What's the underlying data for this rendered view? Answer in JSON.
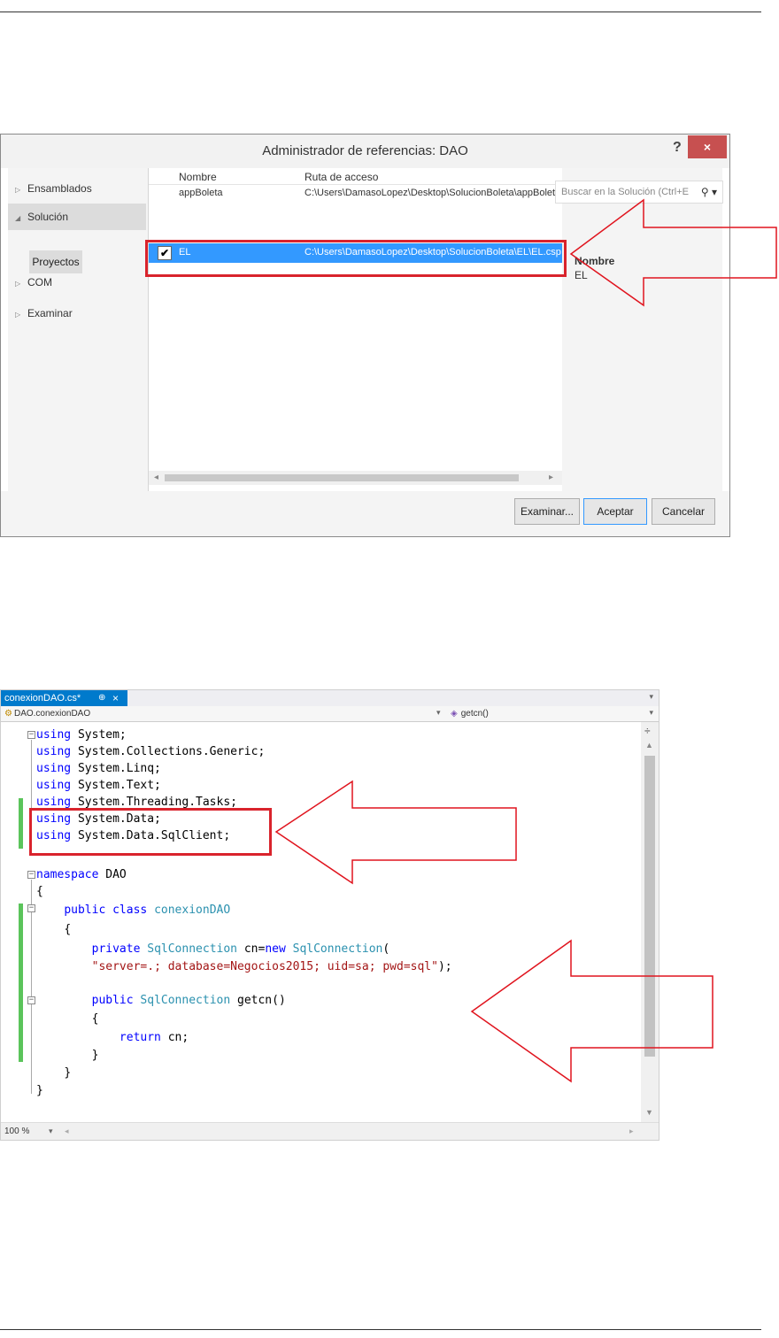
{
  "dialog": {
    "title": "Administrador de referencias: DAO",
    "help_label": "?",
    "close_label": "×",
    "nav": [
      {
        "label": "Ensamblados",
        "expanded": false
      },
      {
        "label": "Solución",
        "expanded": true
      },
      {
        "label": "COM",
        "expanded": false
      },
      {
        "label": "Examinar",
        "expanded": false
      }
    ],
    "nav_subitem": "Proyectos",
    "search_placeholder": "Buscar en la Solución (Ctrl+E",
    "columns": {
      "name": "Nombre",
      "path": "Ruta de acceso"
    },
    "rows": [
      {
        "name": "appBoleta",
        "path": "C:\\Users\\DamasoLopez\\Desktop\\SolucionBoleta\\appBoleta",
        "checked": false,
        "selected": false
      },
      {
        "name": "EL",
        "path": "C:\\Users\\DamasoLopez\\Desktop\\SolucionBoleta\\EL\\EL.csproj",
        "checked": true,
        "selected": true
      }
    ],
    "detail": {
      "header": "Nombre",
      "value": "EL"
    },
    "buttons": {
      "browse": "Examinar...",
      "accept": "Aceptar",
      "cancel": "Cancelar"
    }
  },
  "editor": {
    "tab": {
      "name": "conexionDAO.cs*",
      "pin": "⊕",
      "close": "×"
    },
    "nav_left": "DAO.conexionDAO",
    "nav_right": "getcn()",
    "zoom": "100 %",
    "code": {
      "l1_kw": "using",
      "l1_rest": " System;",
      "l2_kw": "using",
      "l2_rest": " System.Collections.Generic;",
      "l3_kw": "using",
      "l3_rest": " System.Linq;",
      "l4_kw": "using",
      "l4_rest": " System.Text;",
      "l5_kw": "using",
      "l5_rest": " System.Threading.Tasks;",
      "l6_kw": "using",
      "l6_rest": " System.Data;",
      "l7_kw": "using",
      "l7_rest": " System.Data.SqlClient;",
      "l9_kw": "namespace",
      "l9_rest": " DAO",
      "l10": "{",
      "l11_kw1": "public",
      "l11_kw2": "class",
      "l11_ty": "conexionDAO",
      "l12": "{",
      "l13_kw": "private",
      "l13_ty1": "SqlConnection",
      "l13_mid": " cn=",
      "l13_kw2": "new",
      "l13_ty2": "SqlConnection",
      "l13_end": "(",
      "l14_str": "\"server=.; database=Negocios2015; uid=sa; pwd=sql\"",
      "l14_end": ");",
      "l16_kw": "public",
      "l16_ty": "SqlConnection",
      "l16_rest": " getcn()",
      "l17": "{",
      "l18_kw": "return",
      "l18_rest": " cn;",
      "l19": "}",
      "l20": "}",
      "l21": "}"
    }
  },
  "annotations": {
    "highlight_color": "#d9232c"
  }
}
